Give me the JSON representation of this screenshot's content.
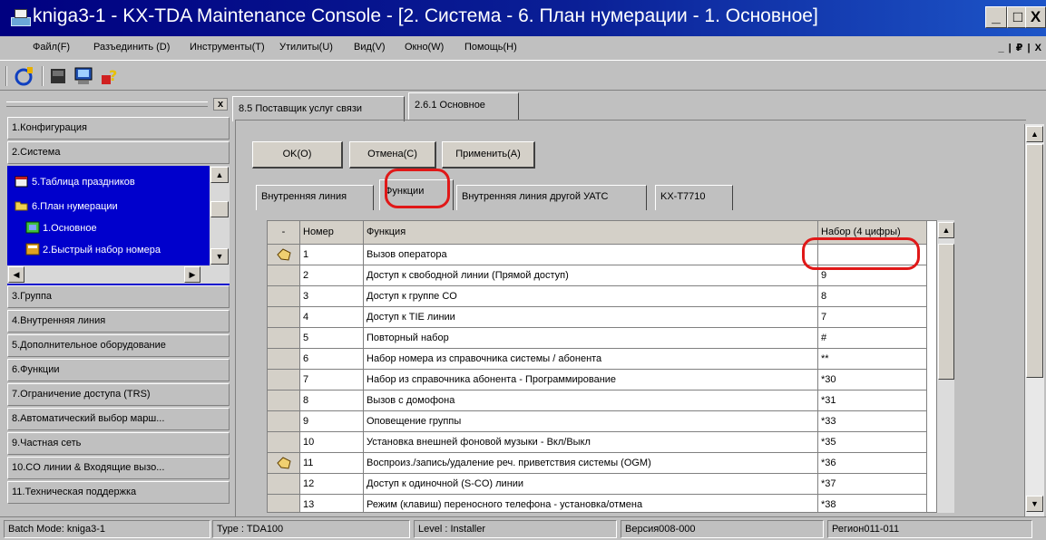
{
  "window": {
    "title": "kniga3-1 - KX-TDA Maintenance Console - [2. Система - 6. План нумерации - 1. Основное]",
    "controls": {
      "minimize": "_",
      "maximize": "□",
      "close": "X"
    }
  },
  "menubar": {
    "items": [
      "Файл(F)",
      "Разъединить (D)",
      "Инструменты(T)",
      "Утилиты(U)",
      "Вид(V)",
      "Окно(W)",
      "Помощь(H)"
    ],
    "mdi_controls": "_ | ₽ | X"
  },
  "left_panel": {
    "close": "x",
    "nav_items": [
      "1.Конфигурация",
      "2.Система",
      "3.Группа",
      "4.Внутренняя линия",
      "5.Дополнительное оборудование",
      "6.Функции",
      "7.Ограничение доступа (TRS)",
      "8.Автоматический выбор марш...",
      "9.Частная сеть",
      "10.CO линии & Входящие вызо...",
      "11.Техническая поддержка"
    ],
    "tree_items": [
      "5.Таблица праздников",
      "6.План нумерации",
      "1.Основное",
      "2.Быстрый набор номера"
    ]
  },
  "doc_tabs": [
    "8.5 Поставщик услуг связи",
    "2.6.1 Основное"
  ],
  "buttons": {
    "ok": "OK(O)",
    "cancel": "Отмена(C)",
    "apply": "Применить(A)"
  },
  "sub_tabs": [
    "Внутренняя линия",
    "Функции",
    "Внутренняя линия другой УАТС",
    "KX-T7710"
  ],
  "grid": {
    "headers": [
      "-",
      "Номер",
      "Функция",
      "Набор (4 цифры)"
    ],
    "rows": [
      {
        "no": "1",
        "fn": "Вызов оператора",
        "val": ""
      },
      {
        "no": "2",
        "fn": "Доступ к свободной линии (Прямой доступ)",
        "val": "9"
      },
      {
        "no": "3",
        "fn": "Доступ к группе CO",
        "val": "8"
      },
      {
        "no": "4",
        "fn": "Доступ к TIE линии",
        "val": "7"
      },
      {
        "no": "5",
        "fn": "Повторный набор",
        "val": "#"
      },
      {
        "no": "6",
        "fn": "Набор номера из справочника системы / абонента",
        "val": "**"
      },
      {
        "no": "7",
        "fn": "Набор из справочника абонента - Программирование",
        "val": "*30"
      },
      {
        "no": "8",
        "fn": "Вызов с домофона",
        "val": "*31"
      },
      {
        "no": "9",
        "fn": "Оповещение группы",
        "val": "*33"
      },
      {
        "no": "10",
        "fn": "Установка внешней фоновой музыки - Вкл/Выкл",
        "val": "*35"
      },
      {
        "no": "11",
        "fn": "Воспроиз./запись/удаление реч. приветствия системы (OGM)",
        "val": "*36"
      },
      {
        "no": "12",
        "fn": "Доступ к одиночной (S-CO) линии",
        "val": "*37"
      },
      {
        "no": "13",
        "fn": "Режим (клавиш) переносного телефона - установка/отмена",
        "val": "*38"
      }
    ]
  },
  "statusbar": {
    "batch": "Batch Mode: kniga3-1",
    "type": "Type : TDA100",
    "level": "Level : Installer",
    "version": "Версия008-000",
    "region": "Регион011-011"
  },
  "colors": {
    "title_start": "#000080",
    "title_end": "#1d55c8",
    "tree_bg": "#0000cc",
    "annotation": "#e01818"
  }
}
